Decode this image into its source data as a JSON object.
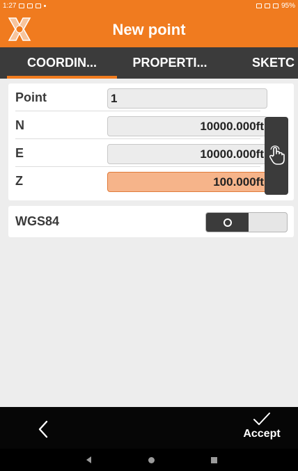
{
  "status_bar": {
    "time": "1:27",
    "battery": "95%"
  },
  "app_bar": {
    "title": "New point",
    "logo_icon": "app-logo-x-icon"
  },
  "tabs": [
    {
      "label": "COORDIN...",
      "active": true
    },
    {
      "label": "PROPERTI...",
      "active": false
    },
    {
      "label": "SKETC",
      "active": false
    }
  ],
  "form": {
    "point": {
      "label": "Point",
      "value": "1"
    },
    "n": {
      "label": "N",
      "value": "10000.000ft"
    },
    "e": {
      "label": "E",
      "value": "10000.000ft"
    },
    "z": {
      "label": "Z",
      "value": "100.000ft"
    },
    "pick_icon": "hand-pointer-icon"
  },
  "wgs84": {
    "label": "WGS84",
    "enabled": false
  },
  "bottom_bar": {
    "back_icon": "chevron-left-icon",
    "accept_label": "Accept",
    "accept_icon": "checkmark-icon"
  },
  "colors": {
    "accent": "#f07b1f",
    "dark": "#3b3b3b",
    "highlight_field": "#f6b48a"
  }
}
